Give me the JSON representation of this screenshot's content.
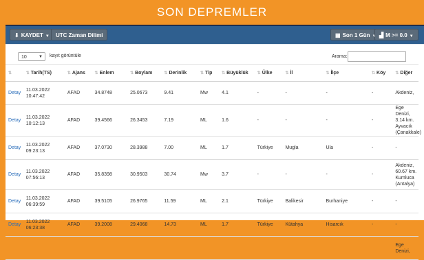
{
  "page_title": "SON DEPREMLER",
  "toolbar": {
    "save_label": "KAYDET",
    "timezone_label": "UTC Zaman Dilimi",
    "period_label": "Son 1 Gün",
    "magnitude_label": "M >= 0.0"
  },
  "controls": {
    "page_length": "10",
    "page_length_label": "kayıt görüntüle",
    "search_label": "Arama:",
    "search_value": ""
  },
  "columns": [
    "Tarih(TS)",
    "Ajans",
    "Enlem",
    "Boylam",
    "Derinlik",
    "Tip",
    "Büyüklük",
    "Ülke",
    "İl",
    "İlçe",
    "Köy",
    "Diğer"
  ],
  "rows": [
    {
      "link": "Detay",
      "date": "11.03.2022",
      "time": "10:47:42",
      "agency": "AFAD",
      "lat": "34.8748",
      "lon": "25.0673",
      "depth": "9.41",
      "type": "Mw",
      "mag": "4.1",
      "country": "-",
      "city": "-",
      "district": "-",
      "village": "-",
      "other": "Akdeniz,"
    },
    {
      "link": "Detay",
      "date": "11.03.2022",
      "time": "10:12:13",
      "agency": "AFAD",
      "lat": "39.4566",
      "lon": "26.3453",
      "depth": "7.19",
      "type": "ML",
      "mag": "1.6",
      "country": "-",
      "city": "-",
      "district": "-",
      "village": "-",
      "other": "Ege Denizi, 3.14 km. Ayvacık (Çanakkale)"
    },
    {
      "link": "Detay",
      "date": "11.03.2022",
      "time": "09:23:13",
      "agency": "AFAD",
      "lat": "37.0730",
      "lon": "28.3988",
      "depth": "7.00",
      "type": "ML",
      "mag": "1.7",
      "country": "Türkiye",
      "city": "Mugla",
      "district": "Ula",
      "village": "-",
      "other": "-"
    },
    {
      "link": "Detay",
      "date": "11.03.2022",
      "time": "07:56:13",
      "agency": "AFAD",
      "lat": "35.8398",
      "lon": "30.9503",
      "depth": "30.74",
      "type": "Mw",
      "mag": "3.7",
      "country": "-",
      "city": "-",
      "district": "-",
      "village": "-",
      "other": "Akdeniz, 60.67 km. Kumluca (Antalya)"
    },
    {
      "link": "Detay",
      "date": "11.03.2022",
      "time": "06:39:59",
      "agency": "AFAD",
      "lat": "39.5105",
      "lon": "26.9765",
      "depth": "11.59",
      "type": "ML",
      "mag": "2.1",
      "country": "Türkiye",
      "city": "Balikesir",
      "district": "Burhaniye",
      "village": "-",
      "other": "-"
    },
    {
      "link": "Detay",
      "date": "11.03.2022",
      "time": "06:23:38",
      "agency": "AFAD",
      "lat": "39.2008",
      "lon": "29.4068",
      "depth": "14.73",
      "type": "ML",
      "mag": "1.7",
      "country": "Türkiye",
      "city": "Kütahya",
      "district": "Hisarcık",
      "village": "-",
      "other": "-"
    },
    {
      "link": "",
      "date": "",
      "time": "",
      "agency": "",
      "lat": "",
      "lon": "",
      "depth": "",
      "type": "",
      "mag": "",
      "country": "",
      "city": "",
      "district": "",
      "village": "",
      "other": "Ege Denizi,"
    }
  ],
  "colors": {
    "orange": "#f29426",
    "navy": "#1c2d4d",
    "toolbar": "#2f5f8f",
    "button": "#5b6b7a",
    "link": "#2a6ebb"
  },
  "icons": [
    "download-icon",
    "sort-icon",
    "calendar-icon",
    "chart-icon",
    "caret-down-icon"
  ]
}
